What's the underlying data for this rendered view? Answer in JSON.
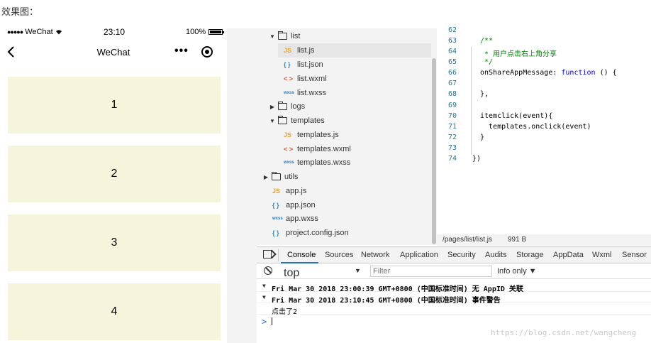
{
  "caption": "效果图：",
  "phone": {
    "status": {
      "carrier": "WeChat",
      "time": "23:10",
      "battery": "100%"
    },
    "nav": {
      "title": "WeChat",
      "more": "•••"
    },
    "items": [
      "1",
      "2",
      "3",
      "4"
    ]
  },
  "filetree": {
    "rows": [
      {
        "label": "list",
        "type": "folder",
        "expanded": true
      },
      {
        "label": "list.js",
        "icon": "JS"
      },
      {
        "label": "list.json",
        "icon": "{ }"
      },
      {
        "label": "list.wxml",
        "icon": "< >"
      },
      {
        "label": "list.wxss",
        "icon": "wxss"
      },
      {
        "label": "logs",
        "type": "folder",
        "expanded": false
      },
      {
        "label": "templates",
        "type": "folder",
        "expanded": true
      },
      {
        "label": "templates.js",
        "icon": "JS"
      },
      {
        "label": "templates.wxml",
        "icon": "< >"
      },
      {
        "label": "templates.wxss",
        "icon": "wxss"
      },
      {
        "label": "utils",
        "type": "folder",
        "expanded": false
      },
      {
        "label": "app.js",
        "icon": "JS"
      },
      {
        "label": "app.json",
        "icon": "{ }"
      },
      {
        "label": "app.wxss",
        "icon": "wxss"
      },
      {
        "label": "project.config.json",
        "icon": "{ }"
      }
    ]
  },
  "editor": {
    "lines": [
      {
        "n": "62",
        "code": ""
      },
      {
        "n": "63",
        "code": "/**"
      },
      {
        "n": "64",
        "code": " * 用户点击右上角分享"
      },
      {
        "n": "65",
        "code": " */"
      },
      {
        "n": "66",
        "code": "onShareAppMessage: ",
        "kw": "function",
        "rest": " () {"
      },
      {
        "n": "67",
        "code": ""
      },
      {
        "n": "68",
        "code": "},"
      },
      {
        "n": "69",
        "code": ""
      },
      {
        "n": "70",
        "code": "itemclick(event){"
      },
      {
        "n": "71",
        "code": "  templates.onclick(event)"
      },
      {
        "n": "72",
        "code": "}"
      },
      {
        "n": "73",
        "code": ""
      },
      {
        "n": "74",
        "code": "})"
      }
    ],
    "status": {
      "path": "/pages/list/list.js",
      "size": "991 B"
    }
  },
  "devtools": {
    "tabs": [
      "Console",
      "Sources",
      "Network",
      "Application",
      "Security",
      "Audits",
      "Storage",
      "AppData",
      "Wxml",
      "Sensor"
    ],
    "active_tab": "Console",
    "context": "top",
    "filter_placeholder": "Filter",
    "levels": "Info only ▼",
    "messages": [
      "Fri Mar 30 2018 23:00:39 GMT+0800 (中国标准时间) 无 AppID 关联",
      "Fri Mar 30 2018 23:10:45 GMT+0800 (中国标准时间) 事件警告",
      "点击了2"
    ],
    "prompt": ">"
  },
  "watermark": "https://blog.csdn.net/wangcheng"
}
